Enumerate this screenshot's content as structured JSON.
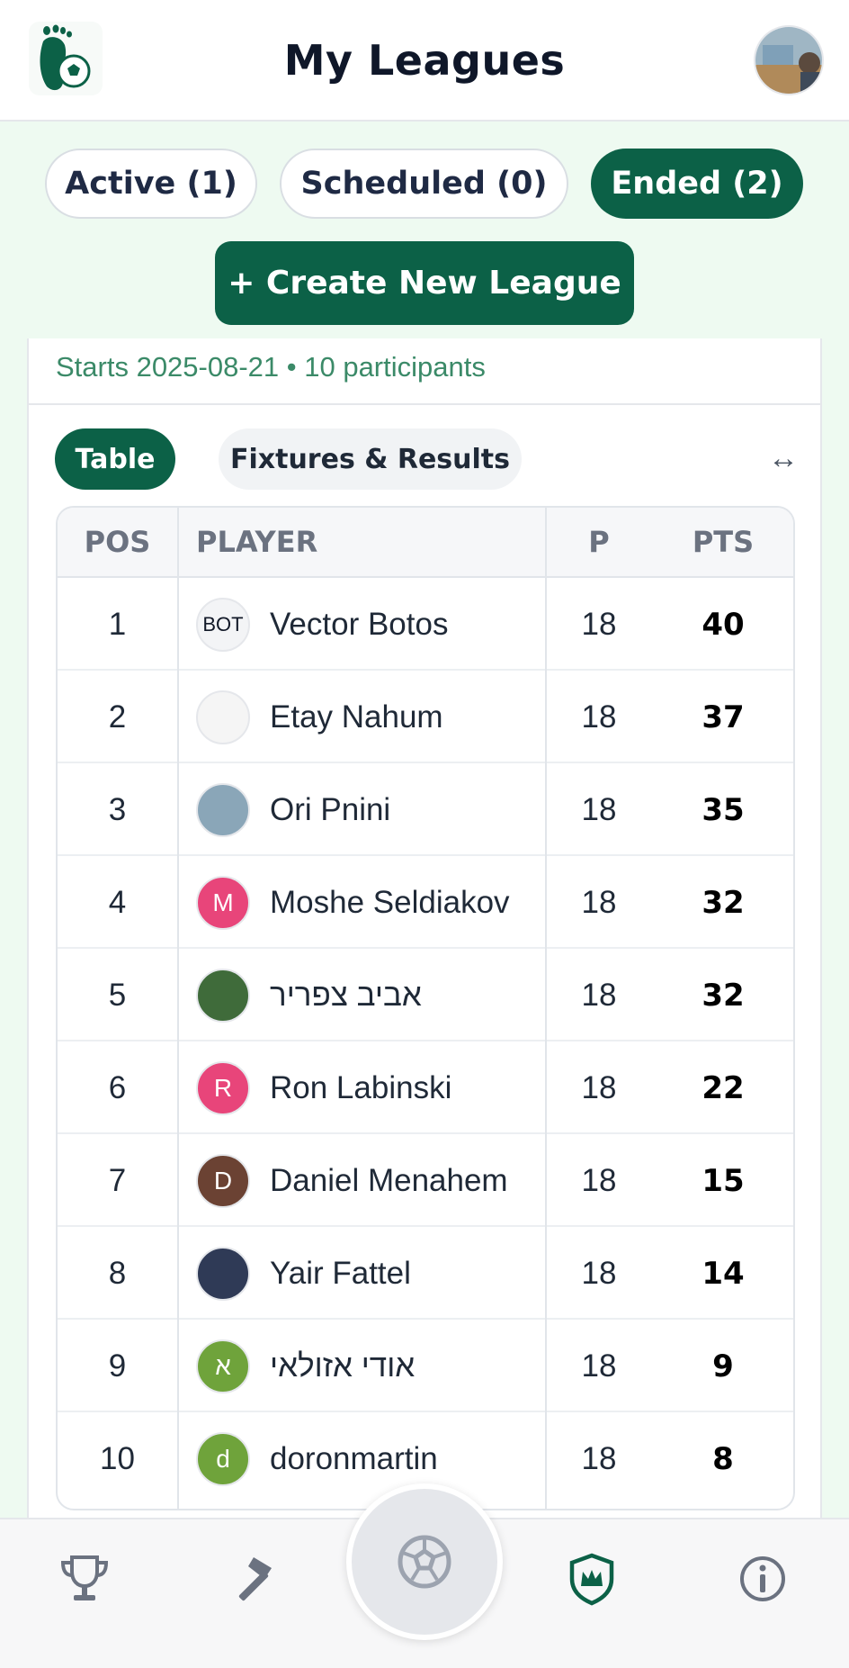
{
  "header": {
    "title": "My Leagues"
  },
  "tabs": [
    {
      "label": "Active (1)",
      "active": false
    },
    {
      "label": "Scheduled (0)",
      "active": false
    },
    {
      "label": "Ended (2)",
      "active": true
    }
  ],
  "create_button": "+ Create New League",
  "league": {
    "subtitle": "Starts 2025-08-21 • 10 participants"
  },
  "view_toggle": {
    "table": "Table",
    "fixtures": "Fixtures & Results",
    "swap_icon": "↔"
  },
  "table": {
    "headers": {
      "pos": "POS",
      "player": "PLAYER",
      "p": "P",
      "pts": "PTS"
    },
    "rows": [
      {
        "pos": "1",
        "name": "Vector Botos",
        "p": "18",
        "pts": "40",
        "avatar_text": "BOT",
        "avatar_color": "#f3f4f6"
      },
      {
        "pos": "2",
        "name": "Etay Nahum",
        "p": "18",
        "pts": "37",
        "avatar_text": "",
        "avatar_color": "#f5f5f5"
      },
      {
        "pos": "3",
        "name": "Ori Pnini",
        "p": "18",
        "pts": "35",
        "avatar_text": "",
        "avatar_color": "#8aa6b8"
      },
      {
        "pos": "4",
        "name": "Moshe Seldiakov",
        "p": "18",
        "pts": "32",
        "avatar_text": "M",
        "avatar_color": "#e8457a"
      },
      {
        "pos": "5",
        "name": "אביב צפריר",
        "p": "18",
        "pts": "32",
        "avatar_text": "",
        "avatar_color": "#3f6b3a"
      },
      {
        "pos": "6",
        "name": "Ron Labinski",
        "p": "18",
        "pts": "22",
        "avatar_text": "R",
        "avatar_color": "#e8457a"
      },
      {
        "pos": "7",
        "name": "Daniel Menahem",
        "p": "18",
        "pts": "15",
        "avatar_text": "D",
        "avatar_color": "#6b4233"
      },
      {
        "pos": "8",
        "name": "Yair Fattel",
        "p": "18",
        "pts": "14",
        "avatar_text": "",
        "avatar_color": "#2f3a56"
      },
      {
        "pos": "9",
        "name": "אודי אזולאי",
        "p": "18",
        "pts": "9",
        "avatar_text": "א",
        "avatar_color": "#6fa33b"
      },
      {
        "pos": "10",
        "name": "doronmartin",
        "p": "18",
        "pts": "8",
        "avatar_text": "d",
        "avatar_color": "#6fa33b"
      }
    ]
  },
  "nav": {
    "items": [
      "trophy-icon",
      "hammer-icon",
      "soccer-ball-icon",
      "crown-shield-icon",
      "info-icon"
    ],
    "accent": "#0c6147"
  }
}
